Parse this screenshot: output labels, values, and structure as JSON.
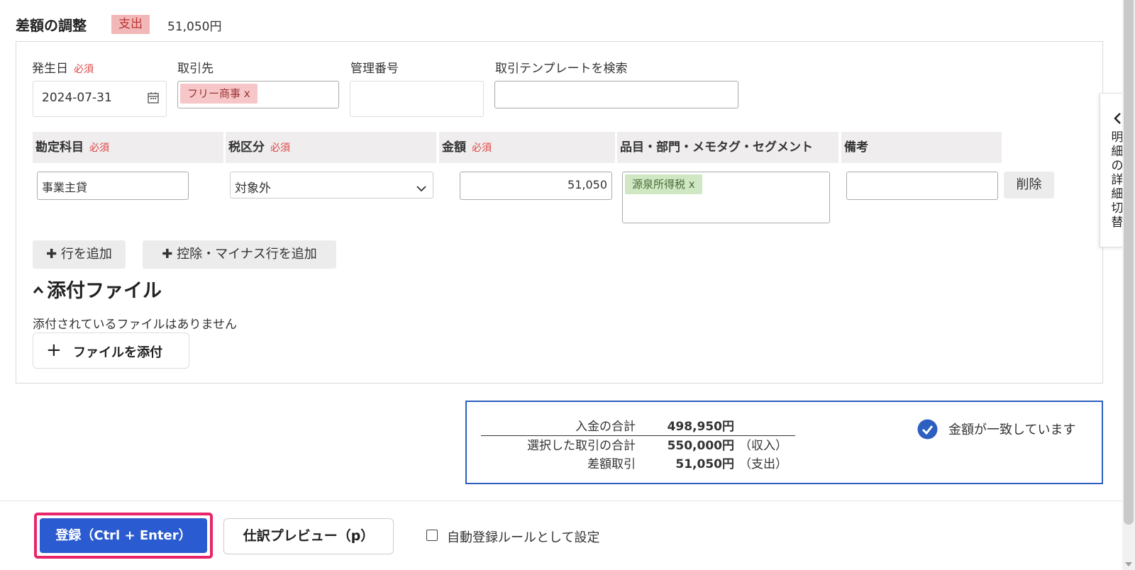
{
  "header": {
    "title": "差額の調整",
    "type_badge": "支出",
    "amount": "51,050円"
  },
  "form": {
    "date_label": "発生日",
    "required": "必須",
    "date_value": "2024-07-31",
    "partner_label": "取引先",
    "partner_chip": "フリー商事 x",
    "ref_number_label": "管理番号",
    "template_search_label": "取引テンプレートを検索"
  },
  "table": {
    "headers": {
      "account": "勘定科目",
      "tax": "税区分",
      "amount": "金額",
      "tags": "品目・部門・メモタグ・セグメント",
      "note": "備考"
    },
    "row": {
      "account": "事業主貸",
      "tax": "対象外",
      "amount": "51,050",
      "tag_chip": "源泉所得税 x",
      "delete_label": "削除"
    }
  },
  "buttons": {
    "add_row": "行を追加",
    "add_deduction_row": "控除・マイナス行を追加",
    "attach_file": "ファイルを添付"
  },
  "attachments": {
    "title": "添付ファイル",
    "empty_message": "添付されているファイルはありません"
  },
  "summary": {
    "deposit_total_label": "入金の合計",
    "deposit_total_value": "498,950円",
    "selected_total_label": "選択した取引の合計",
    "selected_total_value": "550,000円",
    "selected_total_type": "（収入）",
    "difference_label": "差額取引",
    "difference_value": "51,050円",
    "difference_type": "（支出）",
    "match_status": "金額が一致しています"
  },
  "footer": {
    "register_label": "登録（Ctrl + Enter）",
    "preview_label": "仕訳プレビュー（p）",
    "auto_rule_label": "自動登録ルールとして設定"
  },
  "side_tab": {
    "label": "明細の詳細切替"
  },
  "colors": {
    "accent_blue": "#2c5fbf",
    "register_button": "#2a5bd0",
    "highlight_border": "#e8256a",
    "required_red": "#d44444"
  }
}
